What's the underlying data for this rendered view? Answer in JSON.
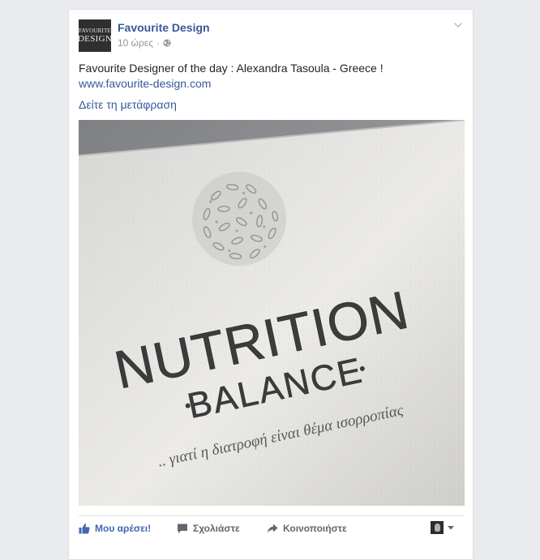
{
  "post": {
    "avatar": {
      "line1": "FAVOURITE",
      "line2": "DESIGN"
    },
    "page_name": "Favourite Design",
    "time": "10 ώρες",
    "separator": "·",
    "privacy_icon": "globe-icon",
    "menu_icon": "chevron-down-icon",
    "text": "Favourite Designer of the day : Alexandra Tasoula - Greece !",
    "link": "www.favourite-design.com",
    "see_translation": "Δείτε τη μετάφραση"
  },
  "image": {
    "title": "NUTRITION",
    "subtitle": "BALANCE",
    "tagline": ".. γιατί η διατροφή είναι θέμα ισορροπίας",
    "ink_color": "#3a3a3a"
  },
  "actions": {
    "like": {
      "label": "Μου αρέσει!",
      "icon": "thumbs-up-icon"
    },
    "comment": {
      "label": "Σχολιάστε",
      "icon": "comment-icon"
    },
    "share": {
      "label": "Κοινοποιήστε",
      "icon": "share-icon"
    },
    "viewer_icon": "caret-down-icon"
  },
  "colors": {
    "link_blue": "#365899",
    "like_blue": "#4267b2",
    "meta_gray": "#90949c",
    "background": "#e9ebee"
  }
}
